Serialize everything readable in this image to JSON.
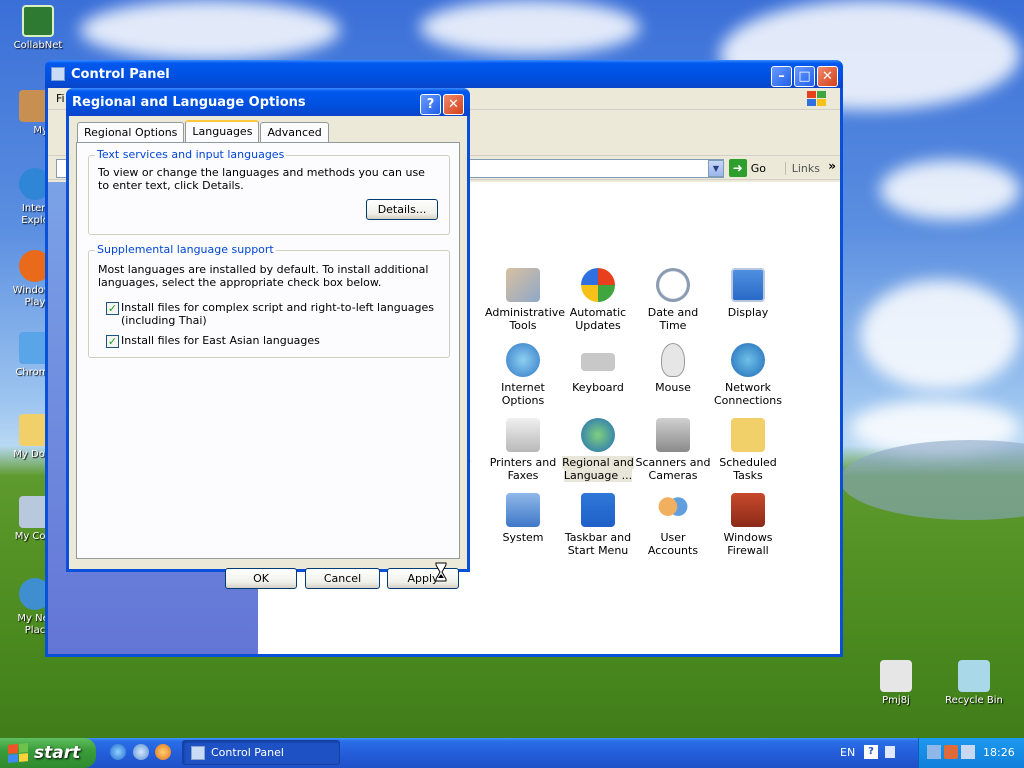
{
  "desktop": {
    "icons": [
      {
        "label": "CollabNet"
      },
      {
        "label": "MyP"
      },
      {
        "label": "Interi"
      },
      {
        "label": "Explo"
      },
      {
        "label": "Windows"
      },
      {
        "label": "Play"
      },
      {
        "label": "Chrome"
      },
      {
        "label": "My Docu"
      },
      {
        "label": "My Com"
      },
      {
        "label": "My Net"
      },
      {
        "label": "Plac"
      },
      {
        "label": "Pmj8j"
      },
      {
        "label": "Recycle Bin"
      }
    ]
  },
  "control_panel": {
    "title": "Control Panel",
    "menu_partial": "Fi",
    "address_partial": "Ad",
    "go_label": "Go",
    "links_label": "Links",
    "items": [
      {
        "label1": "Administrative",
        "label2": "Tools"
      },
      {
        "label1": "Automatic",
        "label2": "Updates"
      },
      {
        "label1": "Date and Time",
        "label2": ""
      },
      {
        "label1": "Display",
        "label2": ""
      },
      {
        "label1": "Internet",
        "label2": "Options"
      },
      {
        "label1": "Keyboard",
        "label2": ""
      },
      {
        "label1": "Mouse",
        "label2": ""
      },
      {
        "label1": "Network",
        "label2": "Connections"
      },
      {
        "label1": "Printers and",
        "label2": "Faxes"
      },
      {
        "label1": "Regional and",
        "label2": "Language ..."
      },
      {
        "label1": "Scanners and",
        "label2": "Cameras"
      },
      {
        "label1": "Scheduled",
        "label2": "Tasks"
      },
      {
        "label1": "System",
        "label2": ""
      },
      {
        "label1": "Taskbar and",
        "label2": "Start Menu"
      },
      {
        "label1": "User Accounts",
        "label2": ""
      },
      {
        "label1": "Windows",
        "label2": "Firewall"
      }
    ],
    "partial_left_1": "s",
    "partial_left_2": "ns"
  },
  "dialog": {
    "title": "Regional and Language Options",
    "tabs": [
      {
        "label": "Regional Options"
      },
      {
        "label": "Languages"
      },
      {
        "label": "Advanced"
      }
    ],
    "group1": {
      "title": "Text services and input languages",
      "text": "To view or change the languages and methods you can use to enter text, click Details.",
      "details_button": "Details..."
    },
    "group2": {
      "title": "Supplemental language support",
      "text": "Most languages are installed by default. To install additional languages, select the appropriate check box below.",
      "check1": "Install files for complex script and right-to-left languages (including Thai)",
      "check2": "Install files for East Asian languages"
    },
    "ok": "OK",
    "cancel": "Cancel",
    "apply": "Apply"
  },
  "taskbar": {
    "start": "start",
    "task": "Control Panel",
    "language": "EN",
    "clock": "18:26"
  }
}
